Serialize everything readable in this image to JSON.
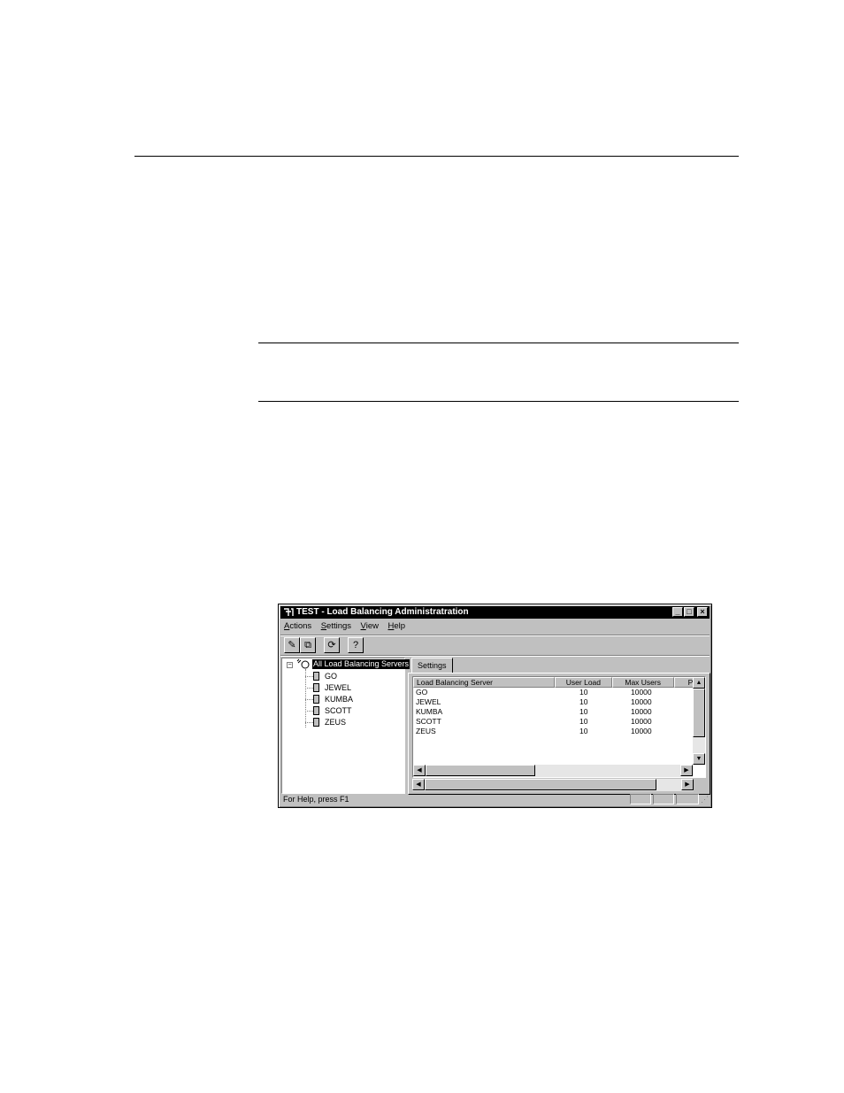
{
  "window": {
    "title": "TEST - Load Balancing Administratration",
    "buttons": {
      "minimize": "_",
      "maximize": "□",
      "close": "×"
    }
  },
  "menubar": {
    "items": [
      "Actions",
      "Settings",
      "View",
      "Help"
    ]
  },
  "toolbar": {
    "buttons": [
      {
        "icon": "pencil-icon",
        "glyph": "✎"
      },
      {
        "icon": "copy-icon",
        "glyph": "⧉"
      },
      {
        "icon": "refresh-icon",
        "glyph": "⟳"
      },
      {
        "icon": "help-icon",
        "glyph": "?"
      }
    ]
  },
  "tree": {
    "expander": "−",
    "root_label": "All Load Balancing Servers",
    "items": [
      "GO",
      "JEWEL",
      "KUMBA",
      "SCOTT",
      "ZEUS"
    ]
  },
  "tabs": [
    "Settings"
  ],
  "table": {
    "columns": [
      "Load Balancing Server",
      "User Load",
      "Max Users",
      "Po"
    ],
    "rows": [
      [
        "GO",
        "10",
        "10000"
      ],
      [
        "JEWEL",
        "10",
        "10000"
      ],
      [
        "KUMBA",
        "10",
        "10000"
      ],
      [
        "SCOTT",
        "10",
        "10000"
      ],
      [
        "ZEUS",
        "10",
        "10000"
      ]
    ]
  },
  "statusbar": {
    "text": "For Help, press F1"
  }
}
